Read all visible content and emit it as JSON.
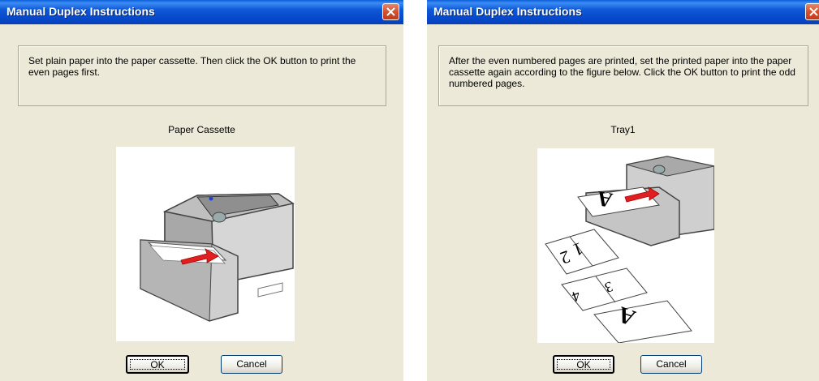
{
  "dialogs": [
    {
      "title": "Manual Duplex Instructions",
      "message": "Set plain paper into the paper cassette. Then click the OK button to print the even pages first.",
      "caption": "Paper Cassette",
      "ok_label": "OK",
      "cancel_label": "Cancel",
      "illustration_icon": "printer-paper-cassette-illustration"
    },
    {
      "title": "Manual Duplex Instructions",
      "message": "After the even numbered pages are printed, set the printed paper into the paper cassette again according to the figure below. Click the OK button to print the odd numbered pages.",
      "caption": "Tray1",
      "ok_label": "OK",
      "cancel_label": "Cancel",
      "illustration_icon": "printer-tray-reinsert-illustration",
      "page_labels": [
        "A",
        "1",
        "2",
        "3",
        "4",
        "A"
      ]
    }
  ],
  "colors": {
    "titlebar": "#0a5fd8",
    "dialog_bg": "#ece9d8",
    "close_button": "#d6502e",
    "arrow": "#e02020"
  }
}
